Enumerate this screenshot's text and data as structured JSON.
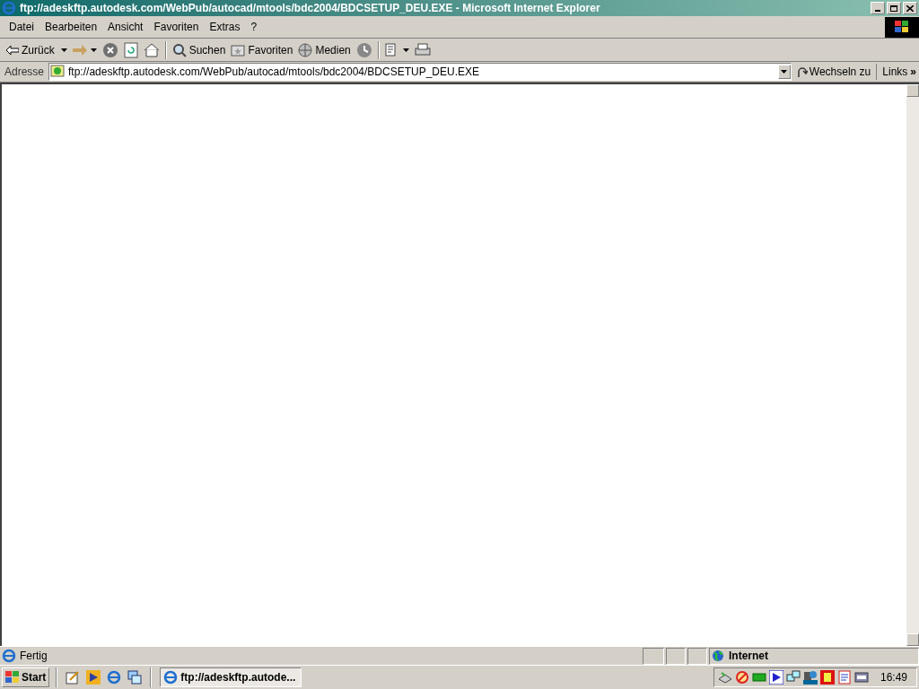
{
  "window": {
    "title": "ftp://adeskftp.autodesk.com/WebPub/autocad/mtools/bdc2004/BDCSETUP_DEU.EXE - Microsoft Internet Explorer"
  },
  "menu": [
    "Datei",
    "Bearbeiten",
    "Ansicht",
    "Favoriten",
    "Extras",
    "?"
  ],
  "toolbar": [
    {
      "kind": "labeled",
      "label": "Zurück",
      "dropdown": true
    },
    {
      "kind": "icon",
      "dropdown": true
    },
    {
      "kind": "icon",
      "dropdown": false
    },
    {
      "kind": "icon",
      "dropdown": false
    },
    {
      "kind": "icon",
      "dropdown": false
    },
    {
      "kind": "separator"
    },
    {
      "kind": "labeled",
      "label": "Suchen",
      "dropdown": false
    },
    {
      "kind": "labeled",
      "label": "Favoriten",
      "dropdown": false
    },
    {
      "kind": "labeled",
      "label": "Medien",
      "dropdown": false
    },
    {
      "kind": "icon",
      "dropdown": false
    },
    {
      "kind": "separator"
    },
    {
      "kind": "icon",
      "dropdown": true
    },
    {
      "kind": "icon",
      "dropdown": false
    }
  ],
  "address": {
    "label": "Adresse",
    "value": "ftp://adeskftp.autodesk.com/WebPub/autocad/mtools/bdc2004/BDCSETUP_DEU.EXE",
    "go": "Wechseln zu",
    "links": "Links",
    "more": "»"
  },
  "status_bar": {
    "text": "Fertig",
    "zone": "Internet"
  },
  "taskbar": {
    "start": "Start",
    "task": "ftp://adeskftp.autode...",
    "clock": "16:49"
  }
}
